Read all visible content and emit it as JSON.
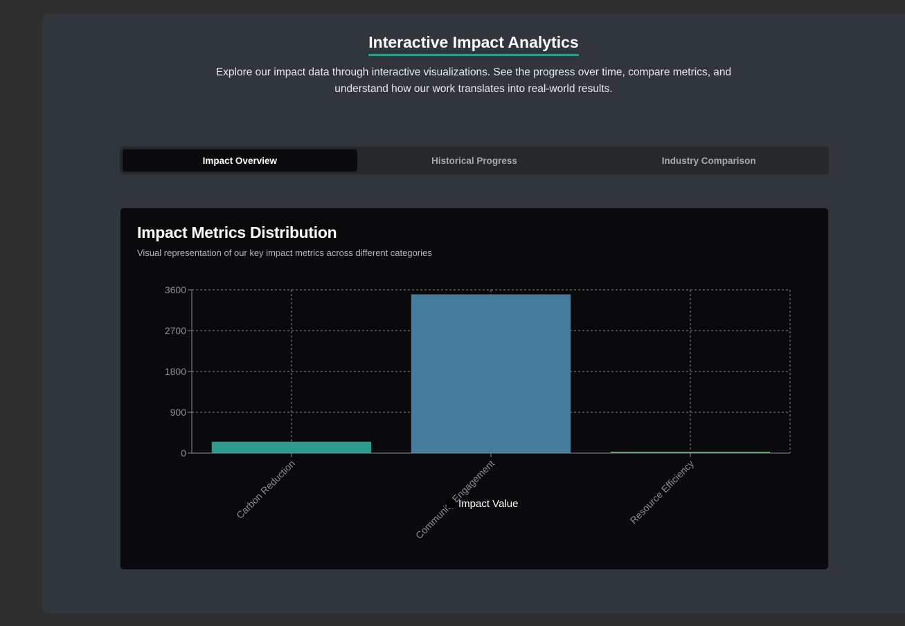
{
  "header": {
    "title": "Interactive Impact Analytics",
    "description": "Explore our impact data through interactive visualizations. See the progress over time, compare metrics, and understand how our work translates into real-world results."
  },
  "tabs": [
    {
      "label": "Impact Overview",
      "active": true
    },
    {
      "label": "Historical Progress",
      "active": false
    },
    {
      "label": "Industry Comparison",
      "active": false
    }
  ],
  "card": {
    "title": "Impact Metrics Distribution",
    "description": "Visual representation of our key impact metrics across different categories"
  },
  "chart_data": {
    "type": "bar",
    "categories": [
      "Carbon Reduction",
      "Community Engagement",
      "Resource Efficiency"
    ],
    "series": [
      {
        "name": "Impact Value",
        "values": [
          250,
          3500,
          30
        ],
        "colors": [
          "#2a9d8f",
          "#457b9d",
          "#4caf50"
        ]
      }
    ],
    "ylim": [
      0,
      3600
    ],
    "yticks": [
      0,
      900,
      1800,
      2700,
      3600
    ],
    "grid": true,
    "legend_position": "bottom"
  }
}
